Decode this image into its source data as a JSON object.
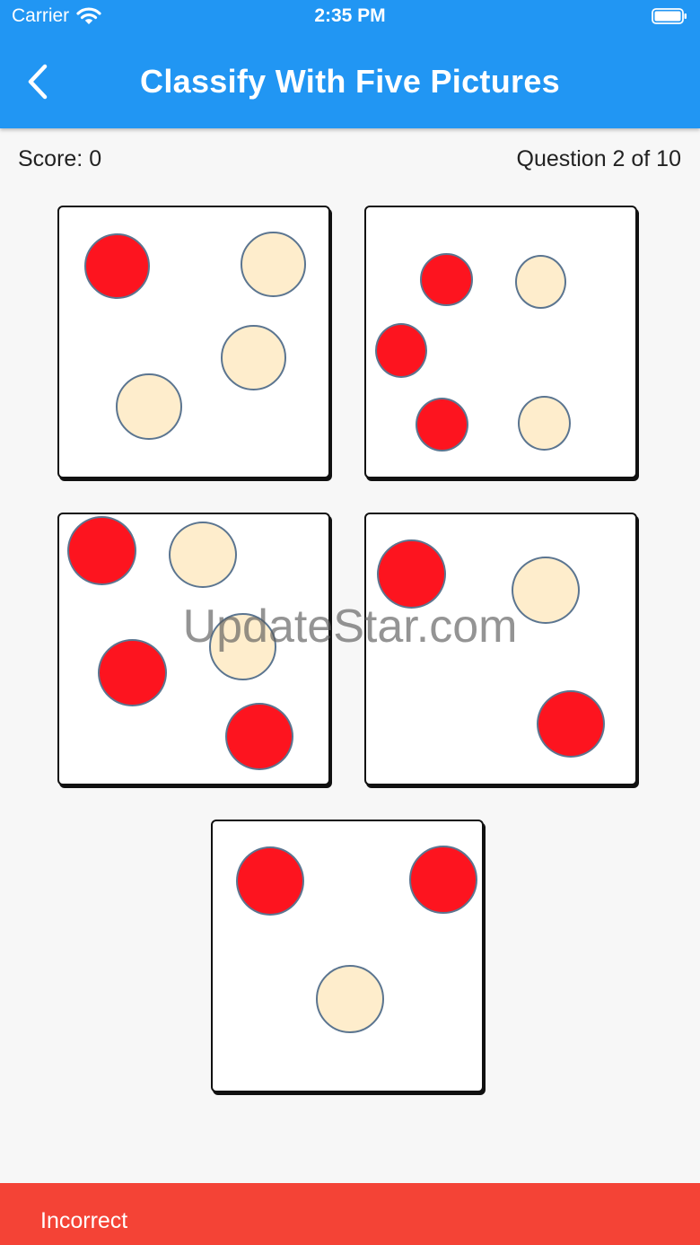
{
  "status_bar": {
    "carrier": "Carrier",
    "time": "2:35 PM",
    "icons": [
      "wifi-icon",
      "battery-icon"
    ]
  },
  "app_bar": {
    "title": "Classify With Five Pictures",
    "back_icon": "chevron-left-icon",
    "color": "#2196f3"
  },
  "game": {
    "score_text": "Score: 0",
    "question_text": "Question 2 of 10"
  },
  "colors": {
    "red_dot": "#fd141f",
    "beige_dot": "#feedcc",
    "dot_border": "#5b7590"
  },
  "pictures": [
    {
      "red_count": 1,
      "beige_count": 3
    },
    {
      "red_count": 3,
      "beige_count": 2
    },
    {
      "red_count": 3,
      "beige_count": 2
    },
    {
      "red_count": 2,
      "beige_count": 1
    },
    {
      "red_count": 2,
      "beige_count": 1
    }
  ],
  "watermark": "UpdateStar.com",
  "snackbar": {
    "text": "Incorrect",
    "color": "#f44336"
  }
}
